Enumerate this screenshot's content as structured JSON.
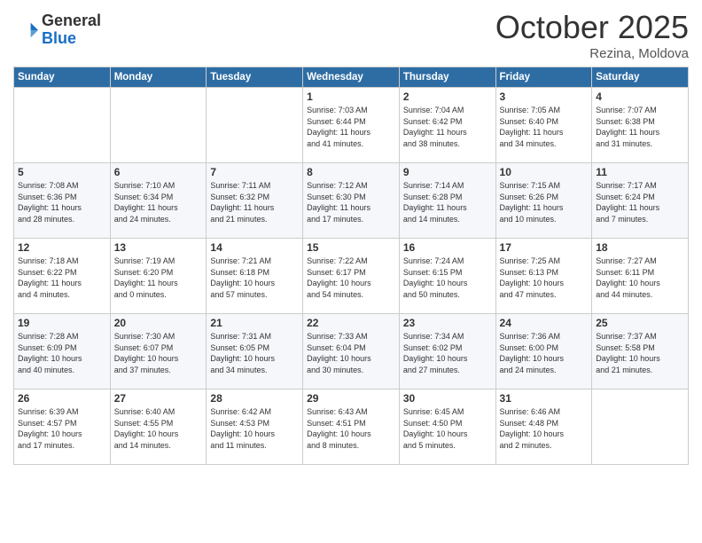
{
  "header": {
    "logo_general": "General",
    "logo_blue": "Blue",
    "month": "October 2025",
    "location": "Rezina, Moldova"
  },
  "weekdays": [
    "Sunday",
    "Monday",
    "Tuesday",
    "Wednesday",
    "Thursday",
    "Friday",
    "Saturday"
  ],
  "weeks": [
    [
      {
        "day": "",
        "info": ""
      },
      {
        "day": "",
        "info": ""
      },
      {
        "day": "",
        "info": ""
      },
      {
        "day": "1",
        "info": "Sunrise: 7:03 AM\nSunset: 6:44 PM\nDaylight: 11 hours\nand 41 minutes."
      },
      {
        "day": "2",
        "info": "Sunrise: 7:04 AM\nSunset: 6:42 PM\nDaylight: 11 hours\nand 38 minutes."
      },
      {
        "day": "3",
        "info": "Sunrise: 7:05 AM\nSunset: 6:40 PM\nDaylight: 11 hours\nand 34 minutes."
      },
      {
        "day": "4",
        "info": "Sunrise: 7:07 AM\nSunset: 6:38 PM\nDaylight: 11 hours\nand 31 minutes."
      }
    ],
    [
      {
        "day": "5",
        "info": "Sunrise: 7:08 AM\nSunset: 6:36 PM\nDaylight: 11 hours\nand 28 minutes."
      },
      {
        "day": "6",
        "info": "Sunrise: 7:10 AM\nSunset: 6:34 PM\nDaylight: 11 hours\nand 24 minutes."
      },
      {
        "day": "7",
        "info": "Sunrise: 7:11 AM\nSunset: 6:32 PM\nDaylight: 11 hours\nand 21 minutes."
      },
      {
        "day": "8",
        "info": "Sunrise: 7:12 AM\nSunset: 6:30 PM\nDaylight: 11 hours\nand 17 minutes."
      },
      {
        "day": "9",
        "info": "Sunrise: 7:14 AM\nSunset: 6:28 PM\nDaylight: 11 hours\nand 14 minutes."
      },
      {
        "day": "10",
        "info": "Sunrise: 7:15 AM\nSunset: 6:26 PM\nDaylight: 11 hours\nand 10 minutes."
      },
      {
        "day": "11",
        "info": "Sunrise: 7:17 AM\nSunset: 6:24 PM\nDaylight: 11 hours\nand 7 minutes."
      }
    ],
    [
      {
        "day": "12",
        "info": "Sunrise: 7:18 AM\nSunset: 6:22 PM\nDaylight: 11 hours\nand 4 minutes."
      },
      {
        "day": "13",
        "info": "Sunrise: 7:19 AM\nSunset: 6:20 PM\nDaylight: 11 hours\nand 0 minutes."
      },
      {
        "day": "14",
        "info": "Sunrise: 7:21 AM\nSunset: 6:18 PM\nDaylight: 10 hours\nand 57 minutes."
      },
      {
        "day": "15",
        "info": "Sunrise: 7:22 AM\nSunset: 6:17 PM\nDaylight: 10 hours\nand 54 minutes."
      },
      {
        "day": "16",
        "info": "Sunrise: 7:24 AM\nSunset: 6:15 PM\nDaylight: 10 hours\nand 50 minutes."
      },
      {
        "day": "17",
        "info": "Sunrise: 7:25 AM\nSunset: 6:13 PM\nDaylight: 10 hours\nand 47 minutes."
      },
      {
        "day": "18",
        "info": "Sunrise: 7:27 AM\nSunset: 6:11 PM\nDaylight: 10 hours\nand 44 minutes."
      }
    ],
    [
      {
        "day": "19",
        "info": "Sunrise: 7:28 AM\nSunset: 6:09 PM\nDaylight: 10 hours\nand 40 minutes."
      },
      {
        "day": "20",
        "info": "Sunrise: 7:30 AM\nSunset: 6:07 PM\nDaylight: 10 hours\nand 37 minutes."
      },
      {
        "day": "21",
        "info": "Sunrise: 7:31 AM\nSunset: 6:05 PM\nDaylight: 10 hours\nand 34 minutes."
      },
      {
        "day": "22",
        "info": "Sunrise: 7:33 AM\nSunset: 6:04 PM\nDaylight: 10 hours\nand 30 minutes."
      },
      {
        "day": "23",
        "info": "Sunrise: 7:34 AM\nSunset: 6:02 PM\nDaylight: 10 hours\nand 27 minutes."
      },
      {
        "day": "24",
        "info": "Sunrise: 7:36 AM\nSunset: 6:00 PM\nDaylight: 10 hours\nand 24 minutes."
      },
      {
        "day": "25",
        "info": "Sunrise: 7:37 AM\nSunset: 5:58 PM\nDaylight: 10 hours\nand 21 minutes."
      }
    ],
    [
      {
        "day": "26",
        "info": "Sunrise: 6:39 AM\nSunset: 4:57 PM\nDaylight: 10 hours\nand 17 minutes."
      },
      {
        "day": "27",
        "info": "Sunrise: 6:40 AM\nSunset: 4:55 PM\nDaylight: 10 hours\nand 14 minutes."
      },
      {
        "day": "28",
        "info": "Sunrise: 6:42 AM\nSunset: 4:53 PM\nDaylight: 10 hours\nand 11 minutes."
      },
      {
        "day": "29",
        "info": "Sunrise: 6:43 AM\nSunset: 4:51 PM\nDaylight: 10 hours\nand 8 minutes."
      },
      {
        "day": "30",
        "info": "Sunrise: 6:45 AM\nSunset: 4:50 PM\nDaylight: 10 hours\nand 5 minutes."
      },
      {
        "day": "31",
        "info": "Sunrise: 6:46 AM\nSunset: 4:48 PM\nDaylight: 10 hours\nand 2 minutes."
      },
      {
        "day": "",
        "info": ""
      }
    ]
  ]
}
